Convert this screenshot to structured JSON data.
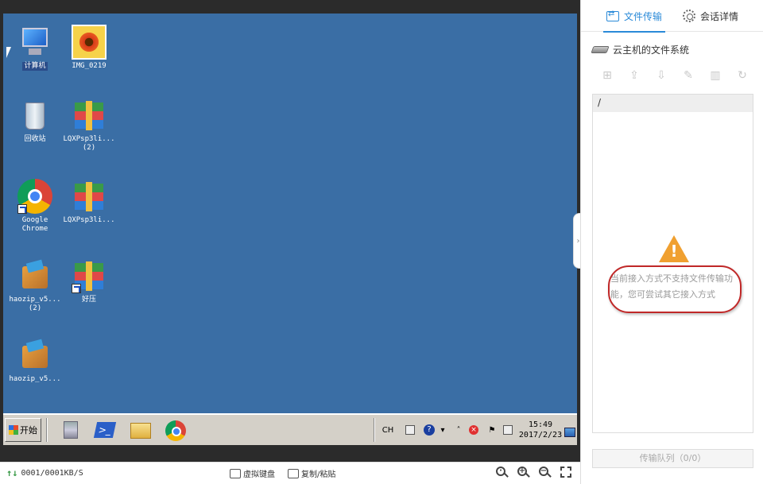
{
  "desktop": {
    "icons": [
      {
        "label": "计算机"
      },
      {
        "label": "IMG_0219"
      },
      {
        "label": "回收站"
      },
      {
        "label": "LQXPsp3li...\n(2)"
      },
      {
        "label": "Google\nChrome"
      },
      {
        "label": "LQXPsp3li..."
      },
      {
        "label": "haozip_v5...\n(2)"
      },
      {
        "label": "好压"
      },
      {
        "label": "haozip_v5..."
      }
    ]
  },
  "taskbar": {
    "start_label": "开始",
    "apps": [
      "server-manager-icon",
      "powershell-icon",
      "explorer-folder-icon",
      "chrome-icon"
    ],
    "tray": {
      "lang": "CH",
      "time": "15:49",
      "date": "2017/2/23"
    }
  },
  "viewer_bar": {
    "speed": "0001/0001KB/S",
    "virtual_keyboard": "虚拟键盘",
    "copy_paste": "复制/粘贴"
  },
  "side": {
    "tabs": [
      {
        "label": "文件传输",
        "active": true
      },
      {
        "label": "会话详情",
        "active": false
      }
    ],
    "fs_title": "云主机的文件系统",
    "path": "/",
    "warning": "当前接入方式不支持文件传输功能，您可尝试其它接入方式",
    "queue": "传输队列（0/0）"
  },
  "colors": {
    "desktop_bg": "#3a6ea5",
    "accent": "#2a8ad8",
    "warning": "#f0a030",
    "annotation_circle": "#c02828"
  }
}
